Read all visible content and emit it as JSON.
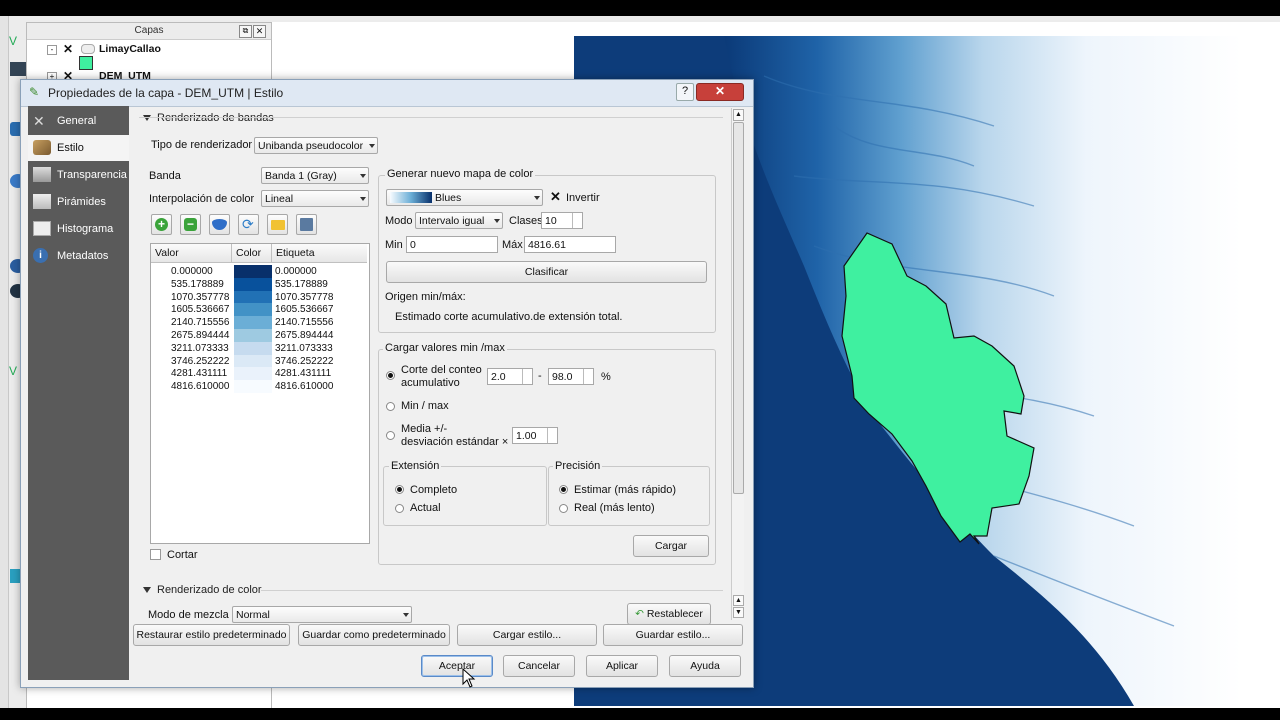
{
  "layers_panel": {
    "title": "Capas",
    "layers": [
      {
        "name": "LimayCallao"
      },
      {
        "name": "DEM_UTM"
      }
    ]
  },
  "dialog": {
    "title": "Propiedades de la capa - DEM_UTM | Estilo",
    "sidebar": [
      {
        "label": "General",
        "icon": "general-tools-icon"
      },
      {
        "label": "Estilo",
        "icon": "brush-icon"
      },
      {
        "label": "Transparencia",
        "icon": "transparency-icon"
      },
      {
        "label": "Pirámides",
        "icon": "pyramid-icon"
      },
      {
        "label": "Histograma",
        "icon": "histogram-icon"
      },
      {
        "label": "Metadatos",
        "icon": "info-icon"
      }
    ],
    "band_render": {
      "section_label": "Renderizado de bandas",
      "renderer_label": "Tipo de renderizador",
      "renderer_value": "Unibanda pseudocolor",
      "band_label": "Banda",
      "band_value": "Banda 1 (Gray)",
      "interp_label": "Interpolación de color",
      "interp_value": "Lineal",
      "table_headers": [
        "Valor",
        "Color",
        "Etiqueta"
      ],
      "entries": [
        {
          "value": "0.000000",
          "color": "#08306b",
          "label": "0.000000"
        },
        {
          "value": "535.178889",
          "color": "#08519c",
          "label": "535.178889"
        },
        {
          "value": "1070.357778",
          "color": "#2171b5",
          "label": "1070.357778"
        },
        {
          "value": "1605.536667",
          "color": "#4292c6",
          "label": "1605.536667"
        },
        {
          "value": "2140.715556",
          "color": "#6baed6",
          "label": "2140.715556"
        },
        {
          "value": "2675.894444",
          "color": "#9ecae1",
          "label": "2675.894444"
        },
        {
          "value": "3211.073333",
          "color": "#c6dbef",
          "label": "3211.073333"
        },
        {
          "value": "3746.252222",
          "color": "#dbe9f6",
          "label": "3746.252222"
        },
        {
          "value": "4281.431111",
          "color": "#eaf2fb",
          "label": "4281.431111"
        },
        {
          "value": "4816.610000",
          "color": "#f7fbff",
          "label": "4816.610000"
        }
      ],
      "clip_label": "Cortar"
    },
    "new_colormap": {
      "group_label": "Generar nuevo mapa de color",
      "ramp_value": "Blues",
      "invert_label": "Invertir",
      "mode_label": "Modo",
      "mode_value": "Intervalo igual",
      "classes_label": "Clases",
      "classes_value": "10",
      "min_label": "Min",
      "min_value": "0",
      "max_label": "Máx",
      "max_value": "4816.61",
      "classify_label": "Clasificar",
      "origin_label": "Origen min/máx:",
      "origin_text": "Estimado corte acumulativo.de extensión total."
    },
    "load_minmax": {
      "group_label": "Cargar valores min /max",
      "cumulative_label_1": "Corte del conteo",
      "cumulative_label_2": "acumulativo",
      "cum_low": "2.0",
      "cum_high": "98.0",
      "percent": "%",
      "dash": "-",
      "minmax_label": "Min / max",
      "mean_label_1": "Media +/-",
      "mean_label_2": "desviación estándar ×",
      "std_value": "1.00",
      "extent_label": "Extensión",
      "extent_full": "Completo",
      "extent_current": "Actual",
      "precision_label": "Precisión",
      "precision_estimate": "Estimar (más rápido)",
      "precision_actual": "Real (más lento)",
      "load_button": "Cargar"
    },
    "color_render": {
      "section_label": "Renderizado de color",
      "blend_label": "Modo de mezcla",
      "blend_value": "Normal",
      "reset_label": "Restablecer"
    },
    "style_buttons": [
      "Restaurar estilo predeterminado",
      "Guardar como predeterminado",
      "Cargar estilo...",
      "Guardar estilo..."
    ],
    "footer_buttons": [
      "Aceptar",
      "Cancelar",
      "Aplicar",
      "Ayuda"
    ],
    "title_help": "?",
    "colors": {
      "accent": "#3ff0a0",
      "sidebar": "#5a5a5a"
    }
  }
}
